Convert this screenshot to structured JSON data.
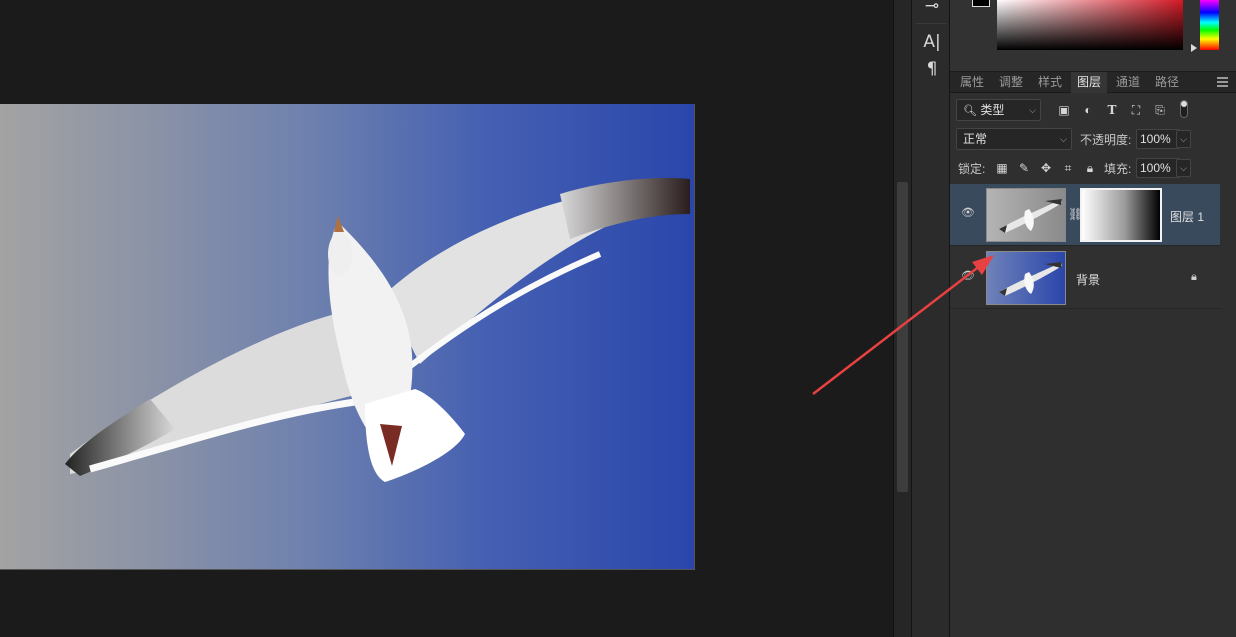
{
  "toolbar": {
    "tools": [
      "text-tool",
      "paragraph-tool"
    ],
    "text_glyph": "A|",
    "paragraph_glyph": "¶"
  },
  "panel_tabs": [
    {
      "label": "属性"
    },
    {
      "label": "调整"
    },
    {
      "label": "样式"
    },
    {
      "label": "图层",
      "active": true
    },
    {
      "label": "通道"
    },
    {
      "label": "路径"
    }
  ],
  "layers_panel": {
    "filter_kind": "类型",
    "blend_mode": "正常",
    "opacity_label": "不透明度:",
    "opacity_value": "100%",
    "lock_label": "锁定:",
    "fill_label": "填充:",
    "fill_value": "100%",
    "layers": [
      {
        "name": "图层 1",
        "selected": true,
        "visible": true,
        "has_mask": true
      },
      {
        "name": "背景",
        "selected": false,
        "visible": true,
        "locked": true
      }
    ]
  },
  "colors": {
    "accent_arrow": "#e84142",
    "selected_layer": "#394a5d"
  }
}
